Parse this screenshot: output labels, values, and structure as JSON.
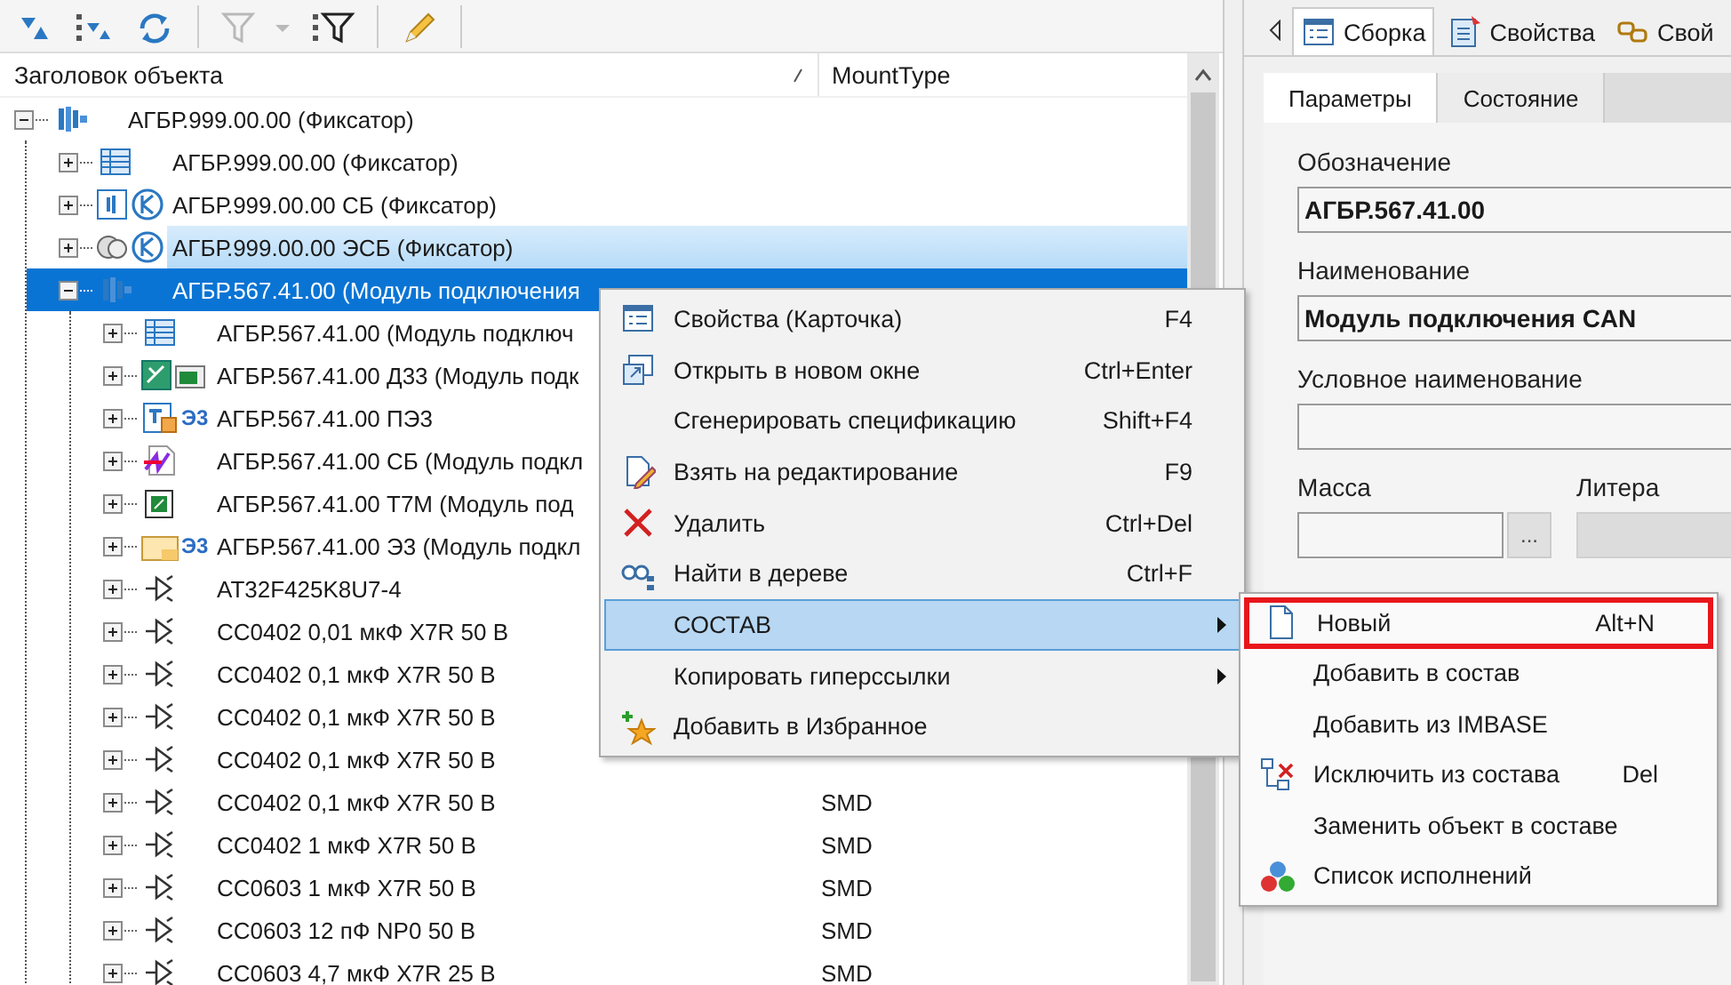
{
  "toolbar": [
    {
      "kind": "sort-down",
      "disabled": false
    },
    {
      "kind": "sort-tree",
      "disabled": false
    },
    {
      "kind": "refresh",
      "disabled": false
    },
    {
      "kind": "separator"
    },
    {
      "kind": "filter",
      "disabled": true
    },
    {
      "kind": "dropdown",
      "disabled": true
    },
    {
      "kind": "filter-list",
      "disabled": false
    },
    {
      "kind": "separator"
    },
    {
      "kind": "edit",
      "disabled": false
    },
    {
      "kind": "separator"
    }
  ],
  "tree": {
    "columns": [
      "Заголовок объекта",
      "MountType"
    ],
    "rows": [
      {
        "title": "АГБР.999.00.00 (Фиксатор)",
        "kind": "assembly",
        "expanded": true,
        "selected": false,
        "hot": false,
        "children": [
          {
            "title": "АГБР.999.00.00 (Фиксатор)",
            "kind": "specification",
            "expanded": false,
            "selected": false,
            "hot": false
          },
          {
            "title": "АГБР.999.00.00 СБ (Фиксатор)",
            "kind": "assembly-doc",
            "expanded": false,
            "selected": false,
            "hot": false
          },
          {
            "title": "АГБР.999.00.00 ЭСБ (Фиксатор)",
            "kind": "circuit-doc",
            "expanded": false,
            "selected": false,
            "hot": true
          },
          {
            "title": "АГБР.567.41.00 (Модуль подключения",
            "kind": "assembly",
            "expanded": true,
            "selected": true,
            "hot": false,
            "children": [
              {
                "title": "АГБР.567.41.00 (Модуль подключ",
                "kind": "specification",
                "expanded": false,
                "selected": false,
                "hot": false
              },
              {
                "title": "АГБР.567.41.00 Д33 (Модуль подк",
                "kind": "pcb",
                "expanded": false,
                "selected": false,
                "hot": false
              },
              {
                "title": "АГБР.567.41.00 ПЭ3",
                "kind": "list-doc",
                "badge": "Э3",
                "expanded": false,
                "selected": false,
                "hot": false
              },
              {
                "title": "АГБР.567.41.00 СБ (Модуль подкл",
                "kind": "drawing",
                "expanded": false,
                "selected": false,
                "hot": false
              },
              {
                "title": "АГБР.567.41.00 Т7М (Модуль под",
                "kind": "model",
                "expanded": false,
                "selected": false,
                "hot": false
              },
              {
                "title": "АГБР.567.41.00 Э3 (Модуль подкл",
                "kind": "scheme",
                "badge": "Э3",
                "expanded": false,
                "selected": false,
                "hot": false
              },
              {
                "title": "AT32F425K8U7-4",
                "kind": "component",
                "expanded": false,
                "selected": false,
                "hot": false
              },
              {
                "title": "CC0402 0,01 мкФ X7R 50 В",
                "kind": "component",
                "expanded": false,
                "selected": false,
                "hot": false
              },
              {
                "title": "CC0402 0,1 мкФ X7R 50 В",
                "kind": "component",
                "expanded": false,
                "selected": false,
                "hot": false
              },
              {
                "title": "CC0402 0,1 мкФ X7R 50 В",
                "kind": "component",
                "expanded": false,
                "selected": false,
                "hot": false
              },
              {
                "title": "CC0402 0,1 мкФ X7R 50 В",
                "kind": "component",
                "expanded": false,
                "selected": false,
                "hot": false
              },
              {
                "title": "CC0402 0,1 мкФ X7R 50 В",
                "kind": "component",
                "mount": "SMD",
                "expanded": false,
                "selected": false,
                "hot": false
              },
              {
                "title": "CC0402 1 мкФ X7R 50 В",
                "kind": "component",
                "mount": "SMD",
                "expanded": false,
                "selected": false,
                "hot": false
              },
              {
                "title": "CC0603 1 мкФ X7R 50 В",
                "kind": "component",
                "mount": "SMD",
                "expanded": false,
                "selected": false,
                "hot": false
              },
              {
                "title": "CC0603 12 пФ NP0 50 В",
                "kind": "component",
                "mount": "SMD",
                "expanded": false,
                "selected": false,
                "hot": false
              },
              {
                "title": "CC0603 4,7 мкФ X7R 25 В",
                "kind": "component",
                "mount": "SMD",
                "expanded": false,
                "selected": false,
                "hot": false
              }
            ]
          }
        ]
      }
    ]
  },
  "context_menu": {
    "items": [
      {
        "label": "Свойства (Карточка)",
        "shortcut": "F4",
        "kind": "card",
        "submenu": false,
        "selected": false
      },
      {
        "label": "Открыть в новом окне",
        "shortcut": "Ctrl+Enter",
        "kind": "new-window",
        "submenu": false,
        "selected": false
      },
      {
        "label": "Сгенерировать спецификацию",
        "shortcut": "Shift+F4",
        "submenu": false,
        "selected": false
      },
      {
        "label": "Взять на редактирование",
        "shortcut": "F9",
        "kind": "edit",
        "submenu": false,
        "selected": false
      },
      {
        "label": "Удалить",
        "shortcut": "Ctrl+Del",
        "kind": "delete",
        "submenu": false,
        "selected": false
      },
      {
        "label": "Найти в дереве",
        "shortcut": "Ctrl+F",
        "kind": "find",
        "submenu": false,
        "selected": false
      },
      {
        "label": "СОСТАВ",
        "submenu": true,
        "selected": true
      },
      {
        "label": "Копировать гиперссылки",
        "submenu": true,
        "selected": false
      },
      {
        "label": "Добавить в Избранное",
        "kind": "favorite",
        "submenu": false,
        "selected": false
      }
    ]
  },
  "submenu": {
    "items": [
      {
        "label": "Новый",
        "shortcut": "Alt+N",
        "kind": "new",
        "marked": true
      },
      {
        "label": "Добавить в состав",
        "marked": false
      },
      {
        "label": "Добавить из IMBASE",
        "marked": false
      },
      {
        "label": "Исключить из состава",
        "shortcut": "Del",
        "kind": "exclude",
        "marked": false
      },
      {
        "label": "Заменить объект в составе",
        "marked": false
      },
      {
        "label": "Список исполнений",
        "kind": "variants",
        "marked": false
      }
    ]
  },
  "properties": {
    "tabs": [
      {
        "label": "Сборка",
        "kind": "card",
        "selected": true
      },
      {
        "label": "Свойства",
        "kind": "properties",
        "selected": false
      },
      {
        "label": "Свой",
        "kind": "links",
        "selected": false
      }
    ],
    "subtabs": [
      {
        "label": "Параметры",
        "selected": true
      },
      {
        "label": "Состояние",
        "selected": false
      }
    ],
    "fields": [
      {
        "label": "Обозначение",
        "value": "АГБР.567.41.00"
      },
      {
        "label": "Наименование",
        "value": "Модуль подключения CAN"
      },
      {
        "label": "Условное наименование"
      }
    ],
    "mass": {
      "label": "Масса",
      "button": "..."
    },
    "litera": {
      "label": "Литера",
      "disabled": true
    }
  }
}
